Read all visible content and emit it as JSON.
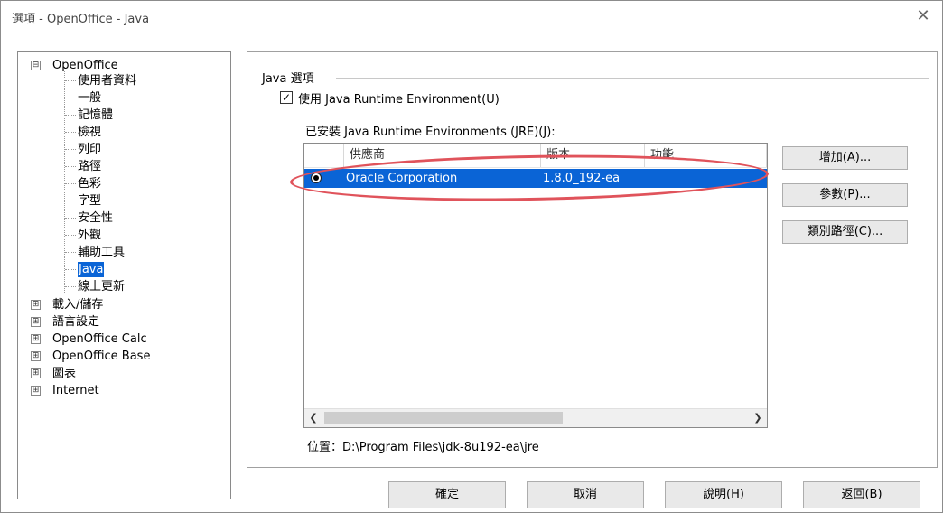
{
  "window": {
    "title": "選項 - OpenOffice - Java",
    "close_glyph": "✕"
  },
  "tree": {
    "root": {
      "label": "OpenOffice",
      "expander": "⊟"
    },
    "children": [
      "使用者資料",
      "一般",
      "記憶體",
      "檢視",
      "列印",
      "路徑",
      "色彩",
      "字型",
      "安全性",
      "外觀",
      "輔助工具",
      "Java",
      "線上更新"
    ],
    "selected": "Java",
    "others": [
      {
        "label": "載入/儲存",
        "expander": "⊞"
      },
      {
        "label": "語言設定",
        "expander": "⊞"
      },
      {
        "label": "OpenOffice Calc",
        "expander": "⊞"
      },
      {
        "label": "OpenOffice Base",
        "expander": "⊞"
      },
      {
        "label": "圖表",
        "expander": "⊞"
      },
      {
        "label": "Internet",
        "expander": "⊞"
      }
    ]
  },
  "java": {
    "group_label": "Java 選項",
    "use_jre_label": "使用 Java Runtime Environment(U)",
    "use_jre_checked": "✓",
    "installed_label": "已安裝 Java Runtime Environments (JRE)(J):",
    "columns": [
      "供應商",
      "版本",
      "功能"
    ],
    "rows": [
      {
        "vendor": "Oracle Corporation",
        "version": "1.8.0_192-ea",
        "features": ""
      }
    ],
    "scroll_left": "❮",
    "scroll_right": "❯",
    "location": "位置：D:\\Program Files\\jdk-8u192-ea\\jre",
    "buttons": {
      "add": "增加(A)...",
      "params": "參數(P)...",
      "classpath": "類別路徑(C)..."
    },
    "highlight_color": "#0a64d6",
    "annotation_color": "#e0535b"
  },
  "footer": {
    "ok": "確定",
    "cancel": "取消",
    "help": "說明(H)",
    "reset": "返回(B)"
  }
}
